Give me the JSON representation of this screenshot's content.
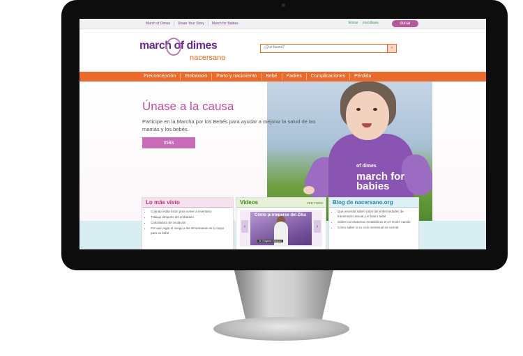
{
  "toplinks": [
    "March of Dimes",
    "Share Your Story",
    "March for Babies"
  ],
  "account": {
    "login": "Entrar",
    "register": "Inscríbase",
    "donate": "donar"
  },
  "logo": {
    "main": "march of dimes",
    "sub": "nacersano"
  },
  "search": {
    "placeholder": "¿Qué busca?",
    "button": "»"
  },
  "nav": [
    "Preconcepción",
    "Embarazo",
    "Parto y nacimiento",
    "Bebé",
    "Padres",
    "Complicaciones",
    "Pérdida"
  ],
  "hero": {
    "title": "Únase a la causa",
    "text": "Participe en la Marcha por los Bebés para ayudar a mejorar la salud de las mamás y los bebés.",
    "button": "más"
  },
  "photo": {
    "shirt_logo": "of dimes",
    "shirt_text": "march for babies"
  },
  "boxes": {
    "most_viewed": {
      "title": "Lo más visto",
      "items": [
        "Cuando están listos para volver a inventario",
        "Trabajo después del embarazo",
        "Calculadora de ovulación",
        "Por qué regar el riesgo a las 39 semanas es lo mejor para su bebé"
      ]
    },
    "videos": {
      "title": "Videos",
      "more": "VER TODO",
      "video_title": "Cómo protegerse del Zika",
      "caption": "Dr. Edgardo Vazquez",
      "prev": "‹",
      "next": "›"
    },
    "blog": {
      "title": "Blog de nacersano.org",
      "items": [
        "Qué necesita saber sobre las enfermedades de transmisión sexual y el futuro bebé",
        "Sobre los trastornos metabólicos en el recién nacido",
        "Cómo saber si su ciclo menstrual es normal"
      ]
    }
  }
}
